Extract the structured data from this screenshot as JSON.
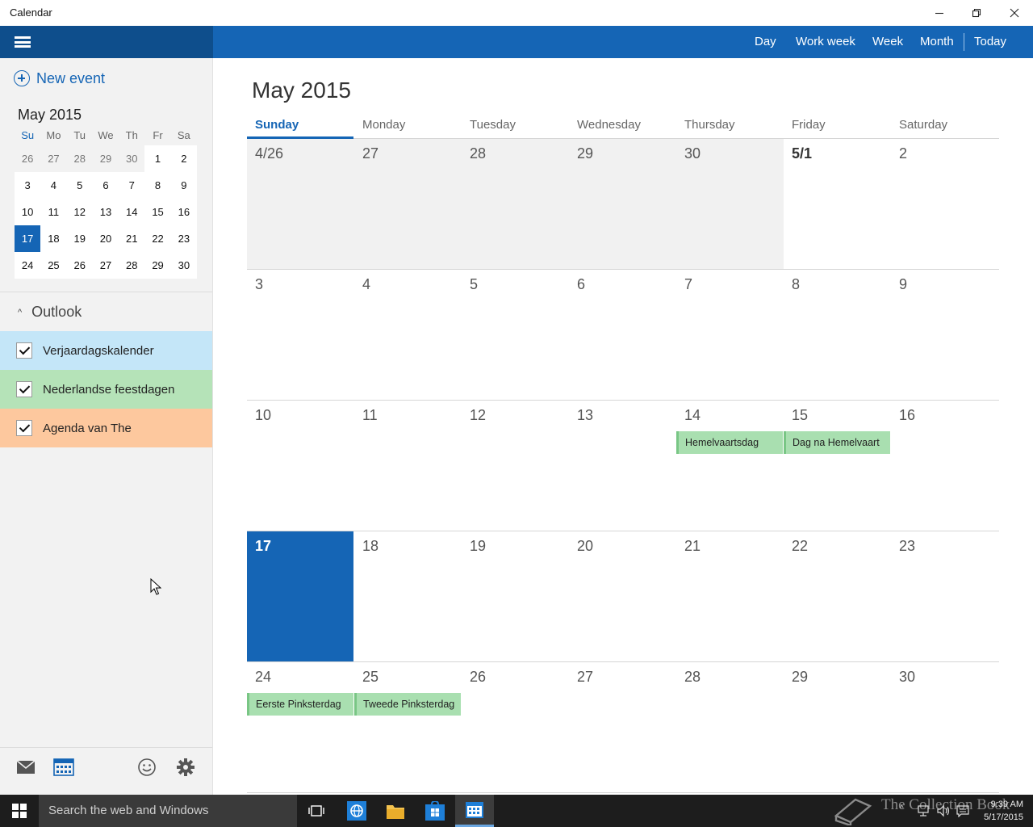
{
  "app": {
    "title": "Calendar"
  },
  "nav": {
    "day": "Day",
    "work_week": "Work week",
    "week": "Week",
    "month": "Month",
    "today": "Today"
  },
  "sidebar": {
    "new_event": "New event",
    "mini_calendar": {
      "title": "May 2015",
      "weekdays": [
        "Su",
        "Mo",
        "Tu",
        "We",
        "Th",
        "Fr",
        "Sa"
      ],
      "weeks": [
        [
          "26",
          "27",
          "28",
          "29",
          "30",
          "1",
          "2"
        ],
        [
          "3",
          "4",
          "5",
          "6",
          "7",
          "8",
          "9"
        ],
        [
          "10",
          "11",
          "12",
          "13",
          "14",
          "15",
          "16"
        ],
        [
          "17",
          "18",
          "19",
          "20",
          "21",
          "22",
          "23"
        ],
        [
          "24",
          "25",
          "26",
          "27",
          "28",
          "29",
          "30"
        ]
      ]
    },
    "account": "Outlook",
    "calendars": [
      {
        "label": "Verjaardagskalender",
        "color": "#c4e6f8"
      },
      {
        "label": "Nederlandse feestdagen",
        "color": "#b5e3b8"
      },
      {
        "label": "Agenda van The",
        "color": "#fdc89e"
      }
    ],
    "bottom_icons": [
      "mail-icon",
      "calendar-icon",
      "feedback-smiley-icon",
      "settings-gear-icon"
    ]
  },
  "main": {
    "month_title": "May 2015",
    "weekdays": [
      "Sunday",
      "Monday",
      "Tuesday",
      "Wednesday",
      "Thursday",
      "Friday",
      "Saturday"
    ],
    "weeks": [
      [
        "4/26",
        "27",
        "28",
        "29",
        "30",
        "5/1",
        "2"
      ],
      [
        "3",
        "4",
        "5",
        "6",
        "7",
        "8",
        "9"
      ],
      [
        "10",
        "11",
        "12",
        "13",
        "14",
        "15",
        "16"
      ],
      [
        "17",
        "18",
        "19",
        "20",
        "21",
        "22",
        "23"
      ],
      [
        "24",
        "25",
        "26",
        "27",
        "28",
        "29",
        "30"
      ]
    ],
    "events": [
      {
        "title": "Hemelvaartsdag",
        "week": 2,
        "day": 4
      },
      {
        "title": "Dag na Hemelvaart",
        "week": 2,
        "day": 5
      },
      {
        "title": "Eerste Pinksterdag",
        "week": 4,
        "day": 0
      },
      {
        "title": "Tweede Pinksterdag",
        "week": 4,
        "day": 1
      }
    ]
  },
  "taskbar": {
    "search_placeholder": "Search the web and Windows",
    "time": "9:39 AM",
    "date": "5/17/2015",
    "watermark": "The Collection Book"
  },
  "colors": {
    "accent": "#1565b5",
    "header_dark": "#0e4e8c",
    "event_green": "#a9dfb0"
  }
}
